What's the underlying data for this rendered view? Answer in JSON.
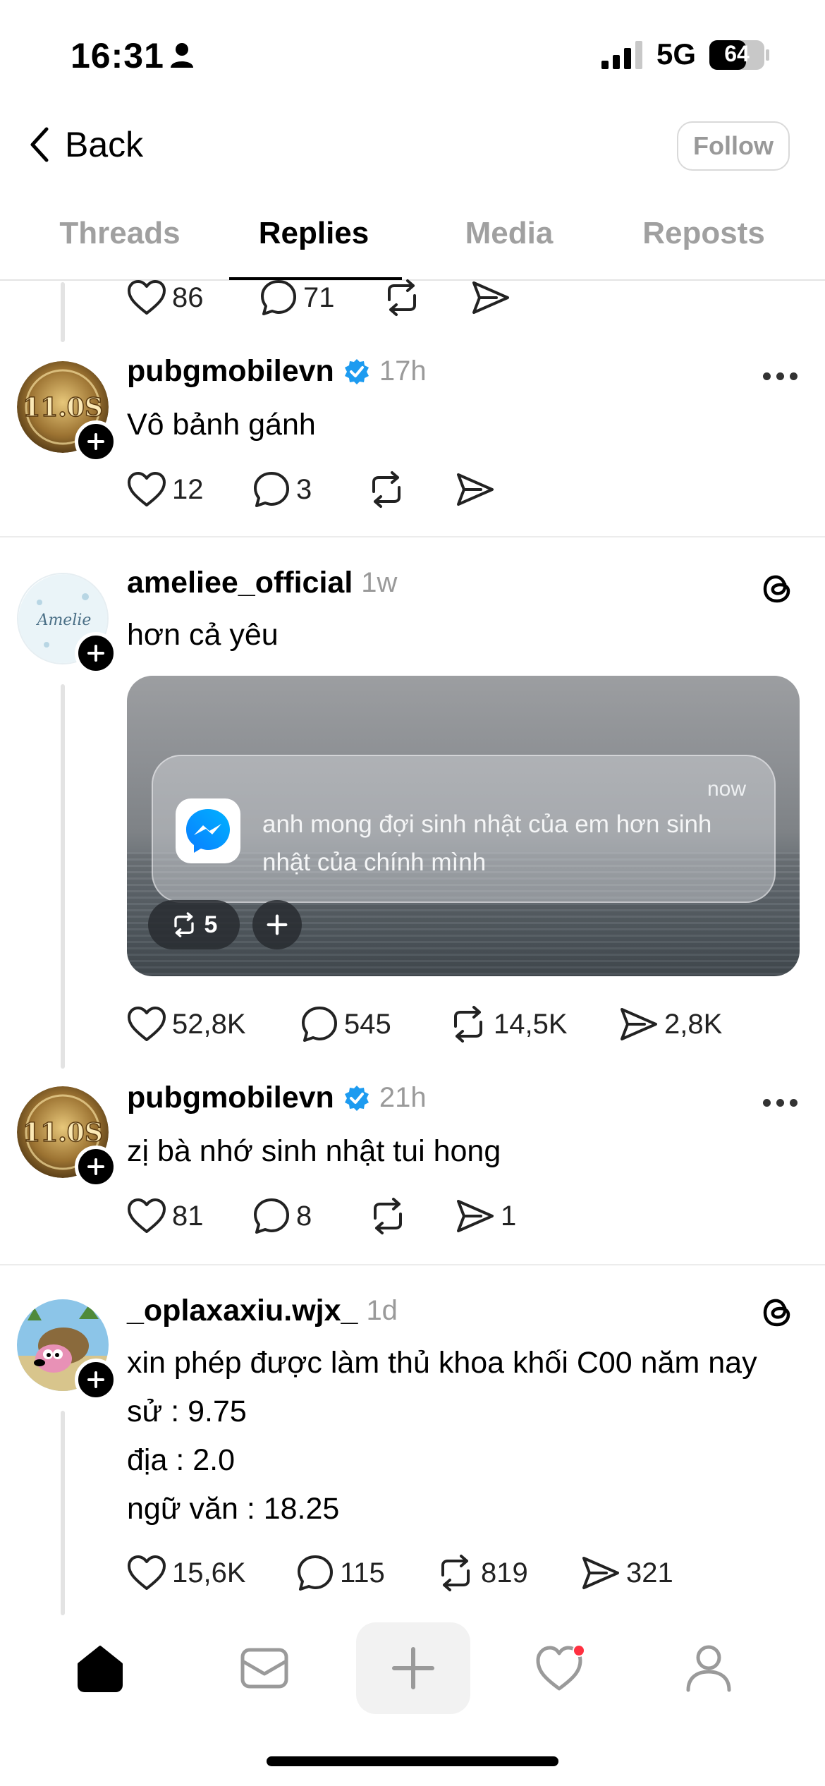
{
  "status_bar": {
    "time": "16:31",
    "network": "5G",
    "battery": "64"
  },
  "header": {
    "back_label": "Back",
    "follow_label": "Follow"
  },
  "tabs": [
    {
      "label": "Threads",
      "active": false
    },
    {
      "label": "Replies",
      "active": true
    },
    {
      "label": "Media",
      "active": false
    },
    {
      "label": "Reposts",
      "active": false
    }
  ],
  "prev_post_actions": {
    "likes": "86",
    "replies": "71"
  },
  "posts": [
    {
      "username": "pubgmobilevn",
      "verified": true,
      "time": "17h",
      "text": "Vô bảnh gánh",
      "likes": "12",
      "replies": "3",
      "reposts": "",
      "shares": ""
    },
    {
      "username": "ameliee_official",
      "verified": false,
      "time": "1w",
      "text": "hơn cả yêu",
      "media": {
        "notification_time": "now",
        "notification_text": "anh mong đợi sinh nhật của em hơn sinh nhật của chính mình",
        "repost_count": "5"
      },
      "likes": "52,8K",
      "replies": "545",
      "reposts": "14,5K",
      "shares": "2,8K"
    },
    {
      "username": "pubgmobilevn",
      "verified": true,
      "time": "21h",
      "text": "zị bà nhớ sinh nhật tui hong",
      "likes": "81",
      "replies": "8",
      "reposts": "",
      "shares": "1"
    },
    {
      "username": "_oplaxaxiu.wjx_",
      "verified": false,
      "time": "1d",
      "text_lines": [
        "xin phép được làm thủ khoa khối C00 năm nay",
        "sử : 9.75",
        "địa : 2.0",
        "ngữ văn : 18.25"
      ],
      "likes": "15,6K",
      "replies": "115",
      "reposts": "819",
      "shares": "321"
    }
  ],
  "avatars": {
    "pubg_text": "11.0S",
    "amelie_text": "Amelie"
  },
  "colors": {
    "verified": "#1d9bf0",
    "notification_dot": "#ff3040",
    "messenger": "#0a7cff"
  },
  "icons": [
    "home-icon",
    "inbox-icon",
    "compose-icon",
    "heart-icon",
    "profile-icon",
    "threads-logo-icon"
  ]
}
